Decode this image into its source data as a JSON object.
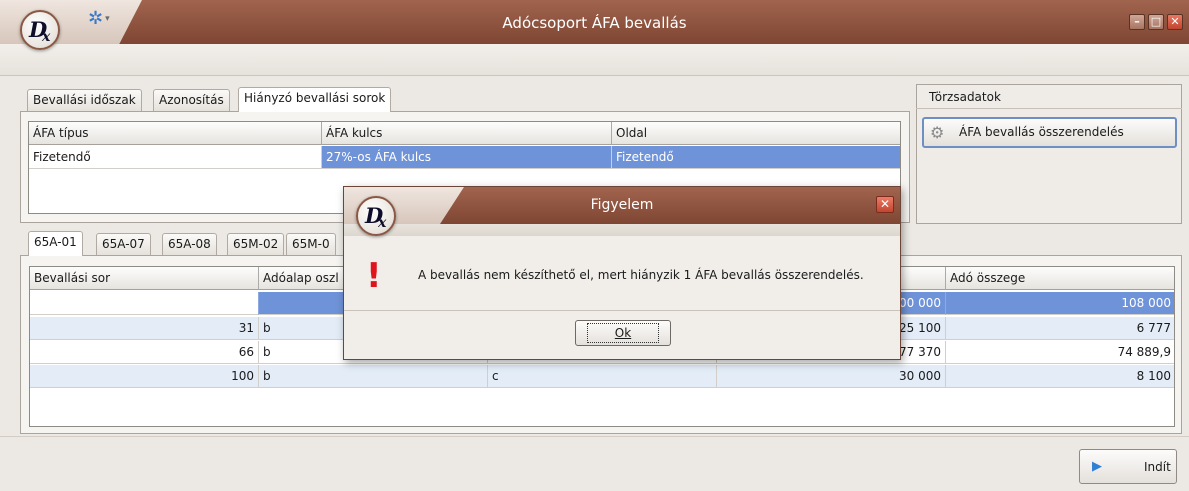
{
  "window": {
    "title": "Adócsoport ÁFA bevallás",
    "minimize": "–",
    "maximize": "□",
    "close": "✕"
  },
  "logo": {
    "letter_main": "D",
    "letter_sub": "x"
  },
  "top_tabs": [
    "Bevallási időszak",
    "Azonosítás",
    "Hiányzó bevallási sorok"
  ],
  "top_grid": {
    "headers": [
      "ÁFA típus",
      "ÁFA kulcs",
      "Oldal"
    ],
    "rows": [
      {
        "afa_tipus": "Fizetendő",
        "afa_kulcs": "27%-os ÁFA kulcs",
        "oldal": "Fizetendő"
      }
    ]
  },
  "right_panel": {
    "title": "Törzsadatok",
    "button_label": "ÁFA bevallás összerendelés"
  },
  "bottom_tabs": [
    "65A-01",
    "65A-07",
    "65A-08",
    "65M-02",
    "65M-0"
  ],
  "bottom_grid": {
    "headers": [
      "Bevallási sor",
      "Adóalap oszl",
      "",
      "",
      "Adó összege"
    ],
    "rows": [
      {
        "sor": "",
        "adoalap": "",
        "c3": "",
        "c4": "00 000",
        "ado": "108 000"
      },
      {
        "sor": "31",
        "adoalap": "b",
        "c3": "",
        "c4": "25 100",
        "ado": "6 777"
      },
      {
        "sor": "66",
        "adoalap": "b",
        "c3": "",
        "c4": "77 370",
        "ado": "74 889,9"
      },
      {
        "sor": "100",
        "adoalap": "b",
        "c3": "c",
        "c4": "30 000",
        "ado": "8 100"
      }
    ]
  },
  "start_button": {
    "label": "Indít"
  },
  "dialog": {
    "title": "Figyelem",
    "close": "✕",
    "icon": "exclamation-icon",
    "icon_glyph": "!",
    "message": "A bevallás nem készíthető el, mert hiányzik 1 ÁFA bevallás összerendelés.",
    "ok_label": "Ok"
  },
  "colors": {
    "titlebar": "#8f533f",
    "selection": "#6f93d8",
    "alt_row": "#e3ecf7",
    "warning": "#e0141c",
    "play": "#2f7fd3"
  }
}
